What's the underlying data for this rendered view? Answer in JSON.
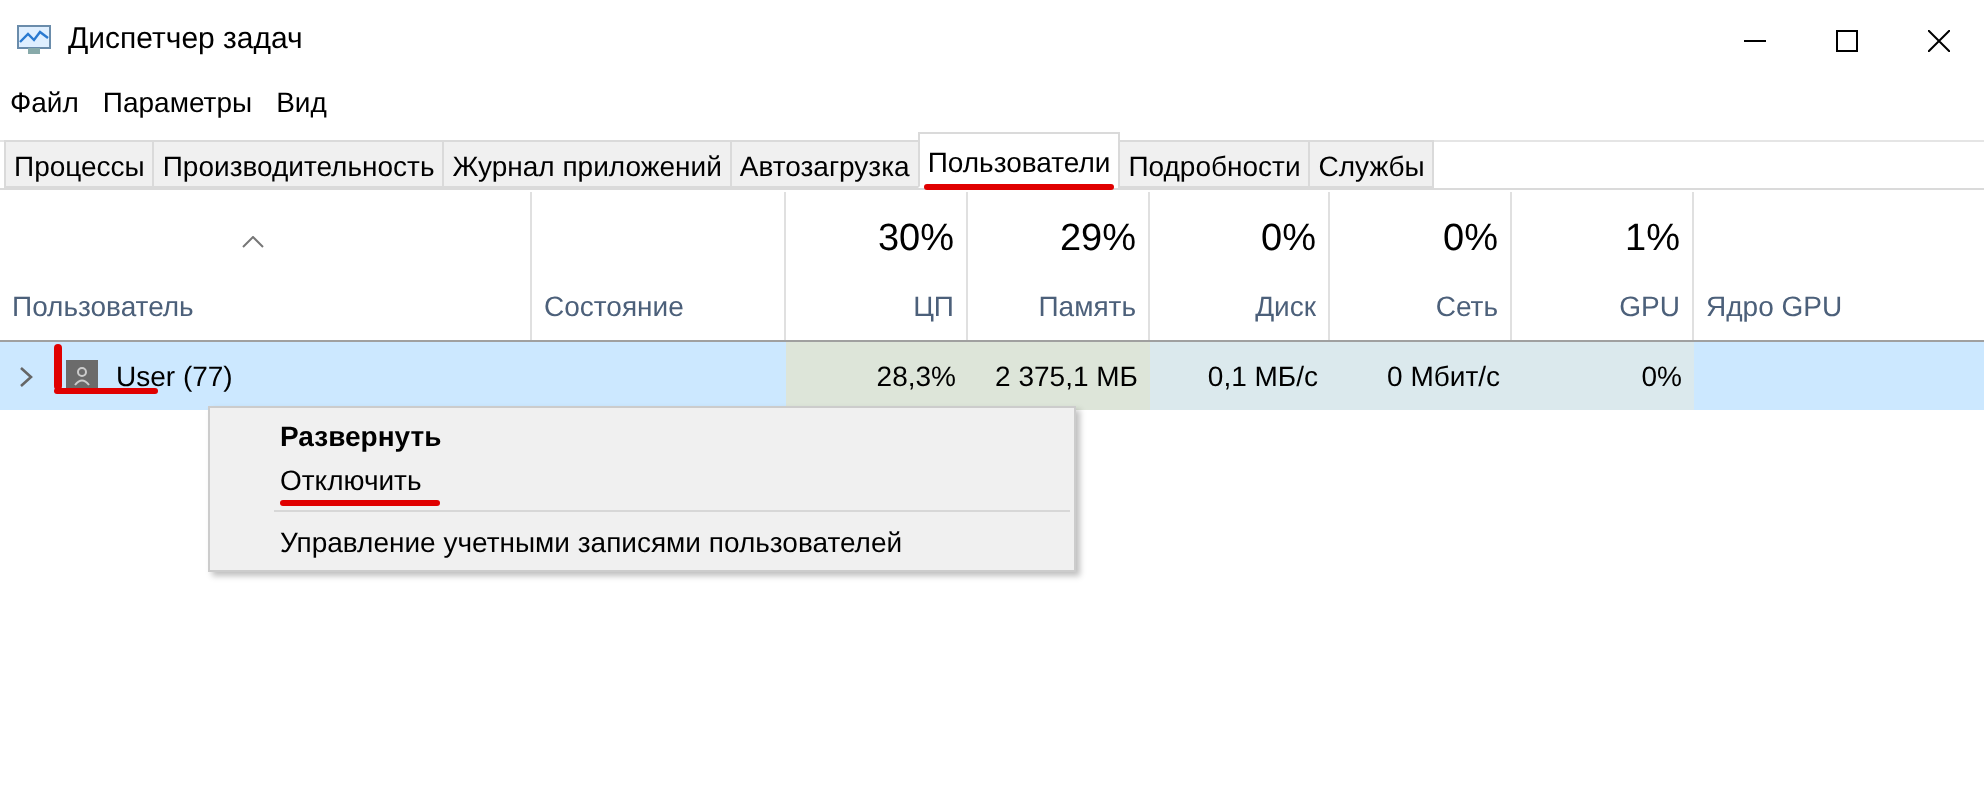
{
  "window": {
    "title": "Диспетчер задач"
  },
  "menu_bar": [
    "Файл",
    "Параметры",
    "Вид"
  ],
  "tabs": [
    {
      "label": "Процессы",
      "selected": false,
      "annotated": false
    },
    {
      "label": "Производительность",
      "selected": false,
      "annotated": false
    },
    {
      "label": "Журнал приложений",
      "selected": false,
      "annotated": false
    },
    {
      "label": "Автозагрузка",
      "selected": false,
      "annotated": false
    },
    {
      "label": "Пользователи",
      "selected": true,
      "annotated": true
    },
    {
      "label": "Подробности",
      "selected": false,
      "annotated": false
    },
    {
      "label": "Службы",
      "selected": false,
      "annotated": false
    }
  ],
  "table": {
    "columns": [
      {
        "label": "Пользователь"
      },
      {
        "label": "Состояние"
      },
      {
        "label": "ЦП",
        "usage": "30%",
        "color": "#dde5d9"
      },
      {
        "label": "Память",
        "usage": "29%",
        "color": "#dde5d9"
      },
      {
        "label": "Диск",
        "usage": "0%",
        "color": "#dbe9ed"
      },
      {
        "label": "Сеть",
        "usage": "0%",
        "color": "#dbe9ed"
      },
      {
        "label": "GPU",
        "usage": "1%",
        "color": "#dbe9ed"
      },
      {
        "label": "Ядро GPU"
      }
    ],
    "rows": [
      {
        "expanded": false,
        "selected": true,
        "annotated": true,
        "cells": [
          "User (77)",
          "",
          "28,3%",
          "2 375,1 МБ",
          "0,1 МБ/с",
          "0 Мбит/с",
          "0%",
          ""
        ]
      }
    ]
  },
  "context_menu": [
    {
      "kind": "item",
      "label": "Развернуть",
      "default": true,
      "annotated": false
    },
    {
      "kind": "item",
      "label": "Отключить",
      "default": false,
      "annotated": true
    },
    {
      "kind": "separator"
    },
    {
      "kind": "item",
      "label": "Управление учетными записями пользователей",
      "default": false,
      "annotated": false
    }
  ]
}
